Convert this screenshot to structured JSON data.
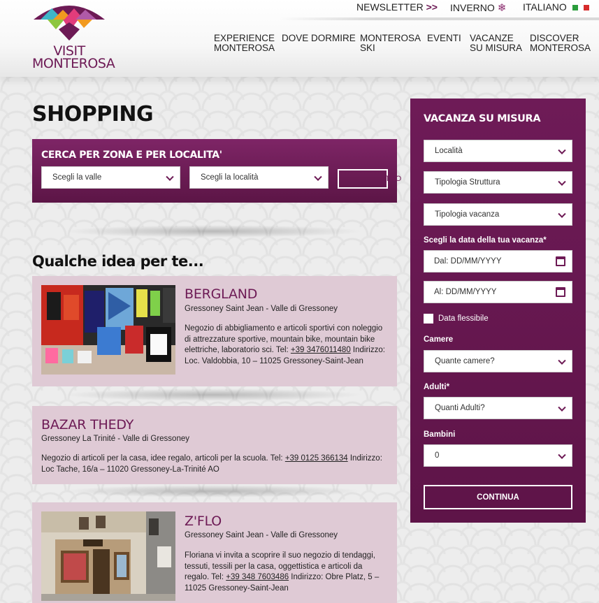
{
  "brand": {
    "line1": "VISIT",
    "line2": "MONTEROSA",
    "color": "#6d1a55"
  },
  "topbar": {
    "newsletter": "NEWSLETTER",
    "newsletter_arrow": ">>",
    "season": "INVERNO",
    "season_icon": "snowflake-icon",
    "language": "ITALIANO",
    "language_icon": "italian-flag-icon"
  },
  "nav": [
    {
      "line1": "EXPERIENCE",
      "line2": "MONTEROSA"
    },
    {
      "line1": "DOVE DORMIRE",
      "line2": ""
    },
    {
      "line1": "MONTEROSA",
      "line2": "SKI"
    },
    {
      "line1": "EVENTI",
      "line2": ""
    },
    {
      "line1": "VACANZE",
      "line2": "SU MISURA"
    },
    {
      "line1": "DISCOVER",
      "line2": "MONTEROSA"
    }
  ],
  "page_title": "SHOPPING",
  "search": {
    "title": "CERCA PER ZONA E PER LOCALITA'",
    "valle_placeholder": "Scegli la valle",
    "localita_placeholder": "Scegli la località",
    "button_label": "TRO"
  },
  "ideas_title": "Qualche idea per te...",
  "cards": [
    {
      "name": "BERGLAND",
      "location": "Gressoney Saint Jean - Valle di Gressoney",
      "desc_before": "Negozio di abbigliamento e articoli sportivi con noleggio di attrezzature sportive, mountain bike, mountain bike elettriche, laboratorio sci. Tel: ",
      "phone": "+39 3476011480",
      "desc_after": " Indirizzo: Loc. Valdobbia, 10 – 11025 Gressoney-Saint-Jean",
      "image": "shop-interior-photo"
    },
    {
      "name": "BAZAR THEDY",
      "location": "Gressoney La Trinité - Valle di Gressoney",
      "desc_before": "Negozio di articoli per la casa, idee regalo, articoli per la scuola. Tel: ",
      "phone": "+39 0125 366134",
      "desc_after": " Indirizzo:  Loc Tache, 16/a – 11020 Gressoney-La-Trinité AO"
    },
    {
      "name": "Z'FLO",
      "location": "Gressoney Saint Jean - Valle di Gressoney",
      "desc_before": "Floriana vi invita a scoprire il suo negozio di tendaggi, tessuti, tessili per la casa, oggettistica e articoli da regalo. Tel: ",
      "phone": "+39 348 7603486",
      "desc_after": " Indirizzo: Obre Platz, 5 – 11025 Gressoney-Saint-Jean",
      "image": "shop-exterior-photo"
    }
  ],
  "sidebar": {
    "title": "VACANZA SU MISURA",
    "localita": "Località",
    "tipologia_struttura": "Tipologia Struttura",
    "tipologia_vacanza": "Tipologia vacanza",
    "date_label": "Scegli la data della tua vacanza*",
    "date_from": "Dal: DD/MM/YYYY",
    "date_to": "Al: DD/MM/YYYY",
    "flexible": "Data flessibile",
    "camere_label": "Camere",
    "camere_placeholder": "Quante camere?",
    "adulti_label": "Adulti*",
    "adulti_placeholder": "Quanti Adulti?",
    "bambini_label": "Bambini",
    "bambini_value": "0",
    "continue": "CONTINUA"
  },
  "colors": {
    "purple": "#6d1a55",
    "card_bg": "#dfcad5",
    "sidebar_bg": "#661852"
  }
}
